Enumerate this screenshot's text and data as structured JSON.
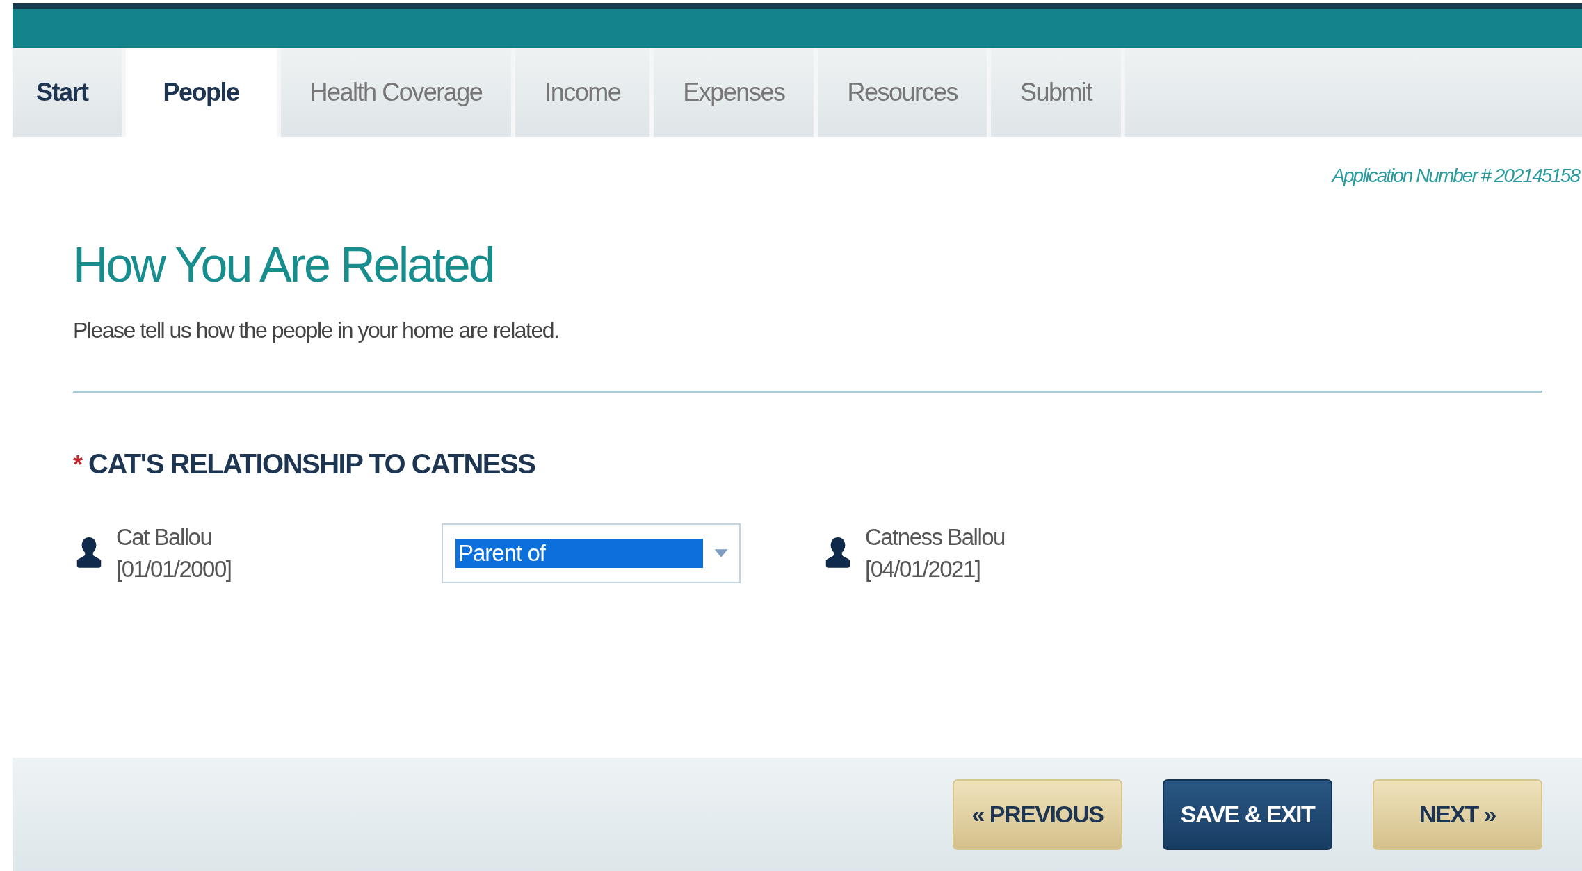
{
  "tabs": [
    {
      "label": "Start",
      "selected": false
    },
    {
      "label": "People",
      "selected": true
    },
    {
      "label": "Health Coverage",
      "selected": false
    },
    {
      "label": "Income",
      "selected": false
    },
    {
      "label": "Expenses",
      "selected": false
    },
    {
      "label": "Resources",
      "selected": false
    },
    {
      "label": "Submit",
      "selected": false
    }
  ],
  "application_number": "Application Number # 202145158",
  "heading": "How You Are Related",
  "intro": "Please tell us how the people in your home are related.",
  "relationship": {
    "label": "CAT'S RELATIONSHIP TO CATNESS",
    "required": true,
    "required_mark": "*",
    "person_from": {
      "name": "Cat Ballou",
      "dob": "[01/01/2000]"
    },
    "select": {
      "value": "Parent of",
      "highlighted": true
    },
    "person_to": {
      "name": "Catness Ballou",
      "dob": "[04/01/2021]"
    }
  },
  "buttons": [
    {
      "label": "« PREVIOUS",
      "kind": "secondary"
    },
    {
      "label": "SAVE & EXIT",
      "kind": "primary"
    },
    {
      "label": "NEXT »",
      "kind": "secondary"
    }
  ]
}
